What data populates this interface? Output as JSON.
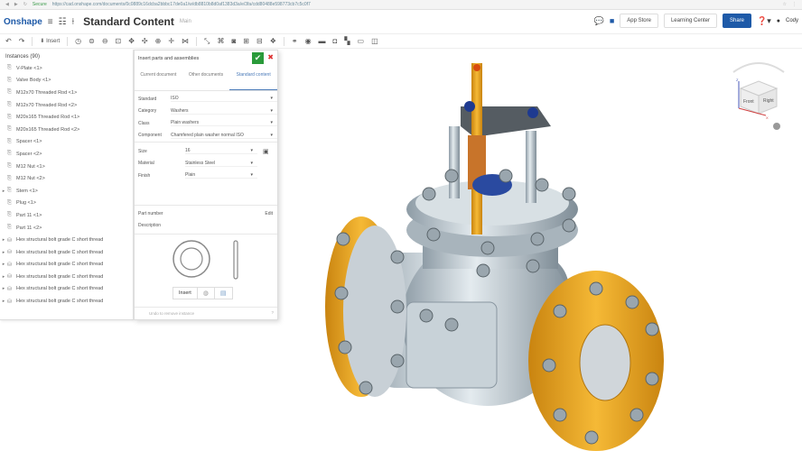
{
  "browser": {
    "secure": "Secure",
    "url": "https://cad.onshape.com/documents/0c0889c16dcba2bbbc17de0a1/w/db8810b8d0af1383d3a/e/3fa/cdd80488e598773cb7c5c0f7"
  },
  "header": {
    "logo": "Onshape",
    "title": "Standard Content",
    "branch": "Main",
    "app_store": "App Store",
    "learning_center": "Learning Center",
    "share": "Share",
    "user": "Cody"
  },
  "toolbar": {
    "insert": "Insert"
  },
  "instances": {
    "title": "Instances (90)",
    "items": [
      {
        "label": "V-Plate <1>",
        "expand": false,
        "type": "part"
      },
      {
        "label": "Valve Body <1>",
        "expand": false,
        "type": "part"
      },
      {
        "label": "M12x70 Threaded Rod <1>",
        "expand": false,
        "type": "part"
      },
      {
        "label": "M12x70 Threaded Rod <2>",
        "expand": false,
        "type": "part"
      },
      {
        "label": "M20x165 Threaded Rod <1>",
        "expand": false,
        "type": "part"
      },
      {
        "label": "M20x165 Threaded Rod <2>",
        "expand": false,
        "type": "part"
      },
      {
        "label": "Spacer <1>",
        "expand": false,
        "type": "part"
      },
      {
        "label": "Spacer <2>",
        "expand": false,
        "type": "part"
      },
      {
        "label": "M12 Nut <1>",
        "expand": false,
        "type": "part"
      },
      {
        "label": "M12 Nut <2>",
        "expand": false,
        "type": "part"
      },
      {
        "label": "Stem <1>",
        "expand": true,
        "type": "part"
      },
      {
        "label": "Plug <1>",
        "expand": false,
        "type": "part"
      },
      {
        "label": "Part 11 <1>",
        "expand": false,
        "type": "part"
      },
      {
        "label": "Part 11 <2>",
        "expand": false,
        "type": "part"
      },
      {
        "label": "Hex structural bolt grade C short thread",
        "expand": true,
        "type": "std"
      },
      {
        "label": "Hex structural bolt grade C short thread",
        "expand": true,
        "type": "std"
      },
      {
        "label": "Hex structural bolt grade C short thread",
        "expand": true,
        "type": "std"
      },
      {
        "label": "Hex structural bolt grade C short thread",
        "expand": true,
        "type": "std"
      },
      {
        "label": "Hex structural bolt grade C short thread",
        "expand": true,
        "type": "std"
      },
      {
        "label": "Hex structural bolt grade C short thread",
        "expand": true,
        "type": "std"
      }
    ]
  },
  "dialog": {
    "title": "Insert parts and assemblies",
    "tabs": [
      "Current document",
      "Other documents",
      "Standard content"
    ],
    "fields": [
      {
        "label": "Standard",
        "value": "ISO"
      },
      {
        "label": "Category",
        "value": "Washers"
      },
      {
        "label": "Class",
        "value": "Plain washers"
      },
      {
        "label": "Component",
        "value": "Chamfered plain washer normal ISO"
      }
    ],
    "params": [
      {
        "label": "Size",
        "value": "16"
      },
      {
        "label": "Material",
        "value": "Stainless Steel"
      },
      {
        "label": "Finish",
        "value": "Plain"
      }
    ],
    "part_number": "Part number",
    "description": "Description",
    "edit": "Edit",
    "insert": "Insert",
    "footer": "Undo to remove instance"
  },
  "viewcube": {
    "front": "Front",
    "right": "Right",
    "z": "Z",
    "x": "X"
  },
  "colors": {
    "accent": "#1e5aa8",
    "ok": "#2a9a3a",
    "flange": "#e8a21e",
    "body": "#b8c4cc"
  }
}
